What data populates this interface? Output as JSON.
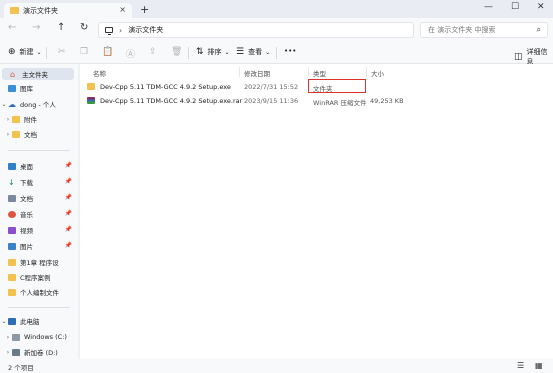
{
  "window": {
    "tab_title": "演示文件夹",
    "new_tab": "+",
    "tab_close": "×",
    "minimize": "—",
    "maximize": "☐",
    "close": "✕"
  },
  "address": {
    "path": "演示文件夹",
    "search_placeholder": "在 演示文件夹 中搜索"
  },
  "toolbar": {
    "new_label": "新建",
    "sort_label": "排序",
    "view_label": "查看",
    "more_label": "•••",
    "details_label": "详细信息"
  },
  "sidebar": {
    "home": "主文件夹",
    "gallery": "图库",
    "onedrive": "dong - 个人",
    "attachments": "附件",
    "documents_od": "文档",
    "desktop": "桌面",
    "downloads": "下载",
    "documents": "文档",
    "music": "音乐",
    "videos": "视频",
    "pictures": "图片",
    "ch1": "第1章 程序设",
    "cprog": "C程序案例",
    "personal": "个人编制文件",
    "thispc": "此电脑",
    "drive_c": "Windows (C:)",
    "drive_d": "新加卷 (D:)"
  },
  "columns": {
    "name": "名称",
    "modified": "修改日期",
    "type": "类型",
    "size": "大小"
  },
  "files": [
    {
      "name": "Dev-Cpp 5.11 TDM-GCC 4.9.2 Setup.exe",
      "modified": "2022/7/31 15:52",
      "type": "文件夹",
      "size": ""
    },
    {
      "name": "Dev-Cpp 5.11 TDM-GCC 4.9.2 Setup.exe.rar",
      "modified": "2023/9/15 11:36",
      "type": "WinRAR 压缩文件",
      "size": "49,253 KB"
    }
  ],
  "status": {
    "count": "2 个项目"
  },
  "colors": {
    "highlight": "#e0322d",
    "folder": "#f2c14e",
    "accent": "#2f6cb6"
  }
}
